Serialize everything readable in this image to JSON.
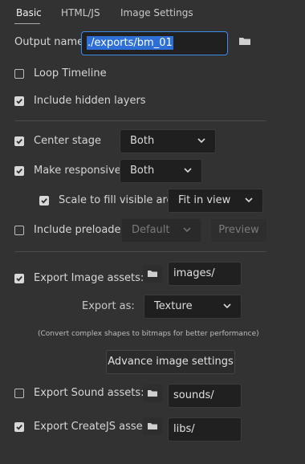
{
  "tabs": [
    {
      "label": "Basic",
      "active": true
    },
    {
      "label": "HTML/JS",
      "active": false
    },
    {
      "label": "Image Settings",
      "active": false
    }
  ],
  "output": {
    "label": "Output name:",
    "value": "./exports/bm_01",
    "browse_icon": "folder-icon"
  },
  "options": {
    "loop_timeline": {
      "label": "Loop Timeline",
      "checked": false
    },
    "include_hidden_layers": {
      "label": "Include hidden layers",
      "checked": true
    },
    "center_stage": {
      "label": "Center stage",
      "checked": true,
      "value": "Both"
    },
    "make_responsive": {
      "label": "Make responsive",
      "checked": true,
      "value": "Both"
    },
    "scale_to_fill": {
      "label": "Scale to fill visible area",
      "checked": true,
      "value": "Fit in view"
    },
    "include_preloader": {
      "label": "Include preloader",
      "checked": false,
      "value": "Default",
      "preview_label": "Preview"
    }
  },
  "assets": {
    "image": {
      "label": "Export Image assets:",
      "checked": true,
      "path": "images/"
    },
    "export_as_label": "Export as:",
    "export_as_value": "Texture",
    "note": "(Convert complex shapes to bitmaps for better performance)",
    "advance_button": "Advance image settings",
    "sound": {
      "label": "Export Sound assets:",
      "checked": false,
      "path": "sounds/"
    },
    "createjs": {
      "label": "Export CreateJS assets:",
      "checked": true,
      "path": "libs/"
    }
  },
  "colors": {
    "background": "#323232",
    "focus_border": "#3b8ee8",
    "selection": "#2d6fd6"
  }
}
